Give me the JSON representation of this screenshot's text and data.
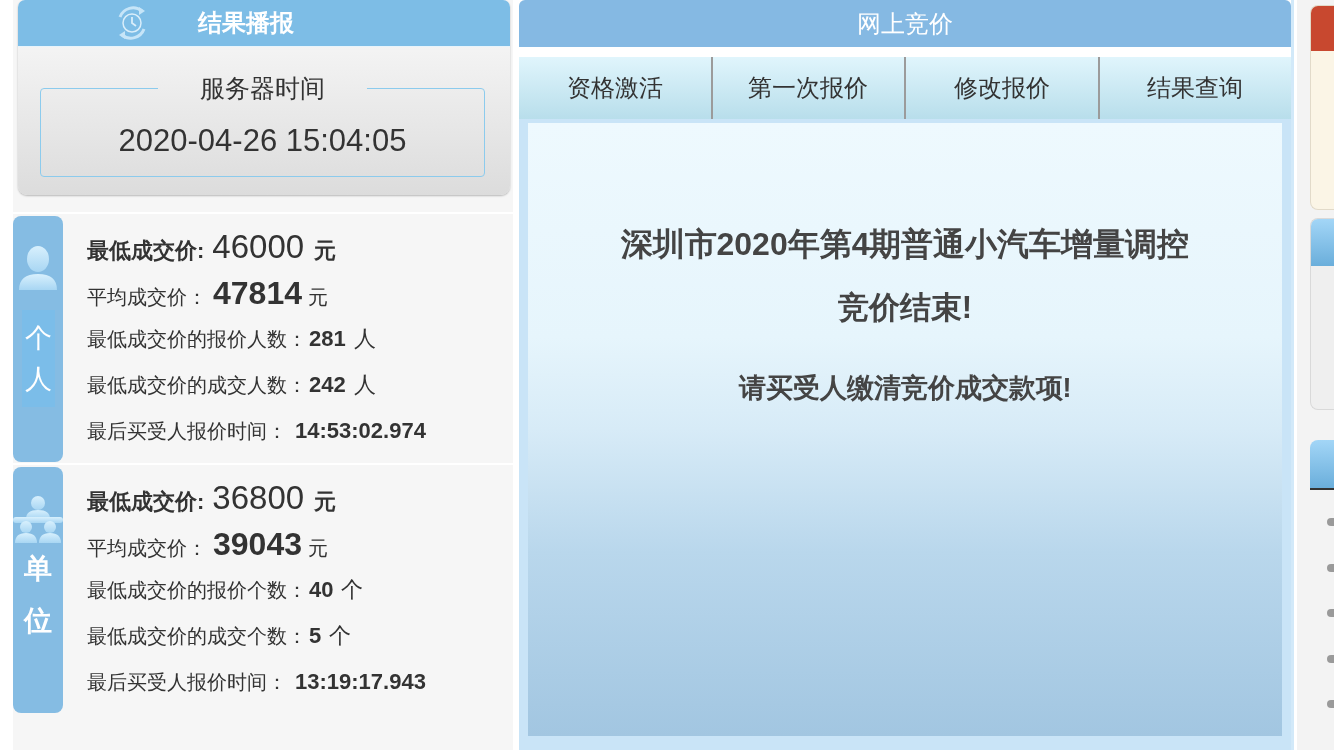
{
  "results_panel": {
    "title": "结果播报",
    "server_time": {
      "label": "服务器时间",
      "value": "2020-04-26 15:04:05"
    }
  },
  "result_groups": [
    {
      "kind": "person",
      "tab_label": "个人",
      "lines": [
        {
          "kind": "lowest",
          "label": "最低成交价:",
          "value": "46000",
          "unit": "元"
        },
        {
          "kind": "average",
          "label": "平均成交价：",
          "value": "47814",
          "unit": "元"
        },
        {
          "kind": "count",
          "label": "最低成交价的报价人数：",
          "value": "281",
          "unit": "人"
        },
        {
          "kind": "count",
          "label": "最低成交价的成交人数：",
          "value": "242",
          "unit": "人"
        },
        {
          "kind": "time",
          "label": "最后买受人报价时间：",
          "value": "14:53:02.974"
        }
      ]
    },
    {
      "kind": "organization",
      "tab_label": "单位",
      "lines": [
        {
          "kind": "lowest",
          "label": "最低成交价:",
          "value": "36800",
          "unit": "元"
        },
        {
          "kind": "average",
          "label": "平均成交价：",
          "value": "39043",
          "unit": "元"
        },
        {
          "kind": "count",
          "label": "最低成交价的报价个数：",
          "value": "40",
          "unit": "个"
        },
        {
          "kind": "count",
          "label": "最低成交价的成交个数：",
          "value": "5",
          "unit": "个"
        },
        {
          "kind": "time",
          "label": "最后买受人报价时间：",
          "value": "13:19:17.943"
        }
      ]
    }
  ],
  "bidding_panel": {
    "title": "网上竞价",
    "tabs": [
      {
        "label": "资格激活",
        "selected": false
      },
      {
        "label": "第一次报价",
        "selected": false
      },
      {
        "label": "修改报价",
        "selected": false
      },
      {
        "label": "结果查询",
        "selected": false
      }
    ],
    "notice": {
      "heading": "深圳市2020年第4期普通小汽车增量调控",
      "status": "竞价结束!",
      "instruction": "请买受人缴清竞价成交款项!"
    }
  }
}
